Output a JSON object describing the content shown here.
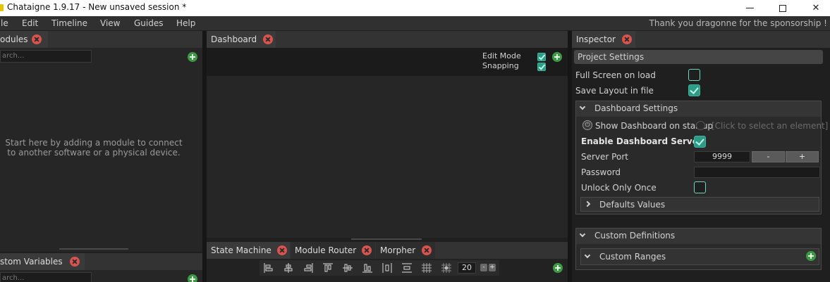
{
  "window": {
    "title": "Chataigne 1.9.17 - New unsaved session *",
    "minimize_icon": "minimize-icon",
    "maximize_icon": "maximize-icon",
    "close_icon": "close-icon"
  },
  "menubar": {
    "items": [
      "le",
      "Edit",
      "Timeline",
      "View",
      "Guides",
      "Help"
    ],
    "sponsor_text": "Thank you dragonne for the sponsorship !"
  },
  "modules_panel": {
    "tab_label": "odules",
    "search_placeholder": "arch...",
    "empty_hint": "Start here by adding a module to connect to another software or a physical device."
  },
  "custom_variables_panel": {
    "tab_label": "stom Variables",
    "search_placeholder": "arch..."
  },
  "dashboard_panel": {
    "tab_label": "Dashboard",
    "edit_mode_label": "Edit Mode",
    "edit_mode_checked": true,
    "snapping_label": "Snapping",
    "snapping_checked": true
  },
  "bottom_tabs": {
    "tabs": [
      "State Machine",
      "Module Router",
      "Morpher"
    ],
    "grid_size": "20",
    "grid_minus": "-",
    "grid_plus": "+",
    "tool_icons": [
      "align-left-icon",
      "align-center-h-icon",
      "align-right-icon",
      "align-top-icon",
      "align-center-v-icon",
      "align-bottom-icon",
      "distribute-h-icon",
      "distribute-v-icon",
      "grid-icon",
      "grid-snap-icon"
    ]
  },
  "inspector": {
    "tab_label": "Inspector",
    "project_settings_label": "Project Settings",
    "full_screen_label": "Full Screen on load",
    "full_screen_checked": false,
    "save_layout_label": "Save Layout in file",
    "save_layout_checked": true,
    "dashboard_settings": {
      "title": "Dashboard Settings",
      "show_on_startup_label": "Show Dashboard on startup",
      "element_placeholder": "[Click to select an element]",
      "enable_server_label": "Enable Dashboard Server",
      "enable_server_checked": true,
      "server_port_label": "Server Port",
      "server_port_value": "9999",
      "port_minus": "-",
      "port_plus": "+",
      "password_label": "Password",
      "password_value": "",
      "unlock_once_label": "Unlock Only Once",
      "unlock_once_checked": false,
      "defaults_values_label": "Defaults Values"
    },
    "custom_definitions": {
      "title": "Custom Definitions",
      "custom_ranges_label": "Custom Ranges"
    }
  },
  "colors": {
    "accent_teal": "#2e9b86",
    "close_red": "#d9534f",
    "add_green": "#3c9a45",
    "panel_bg": "#262626"
  }
}
